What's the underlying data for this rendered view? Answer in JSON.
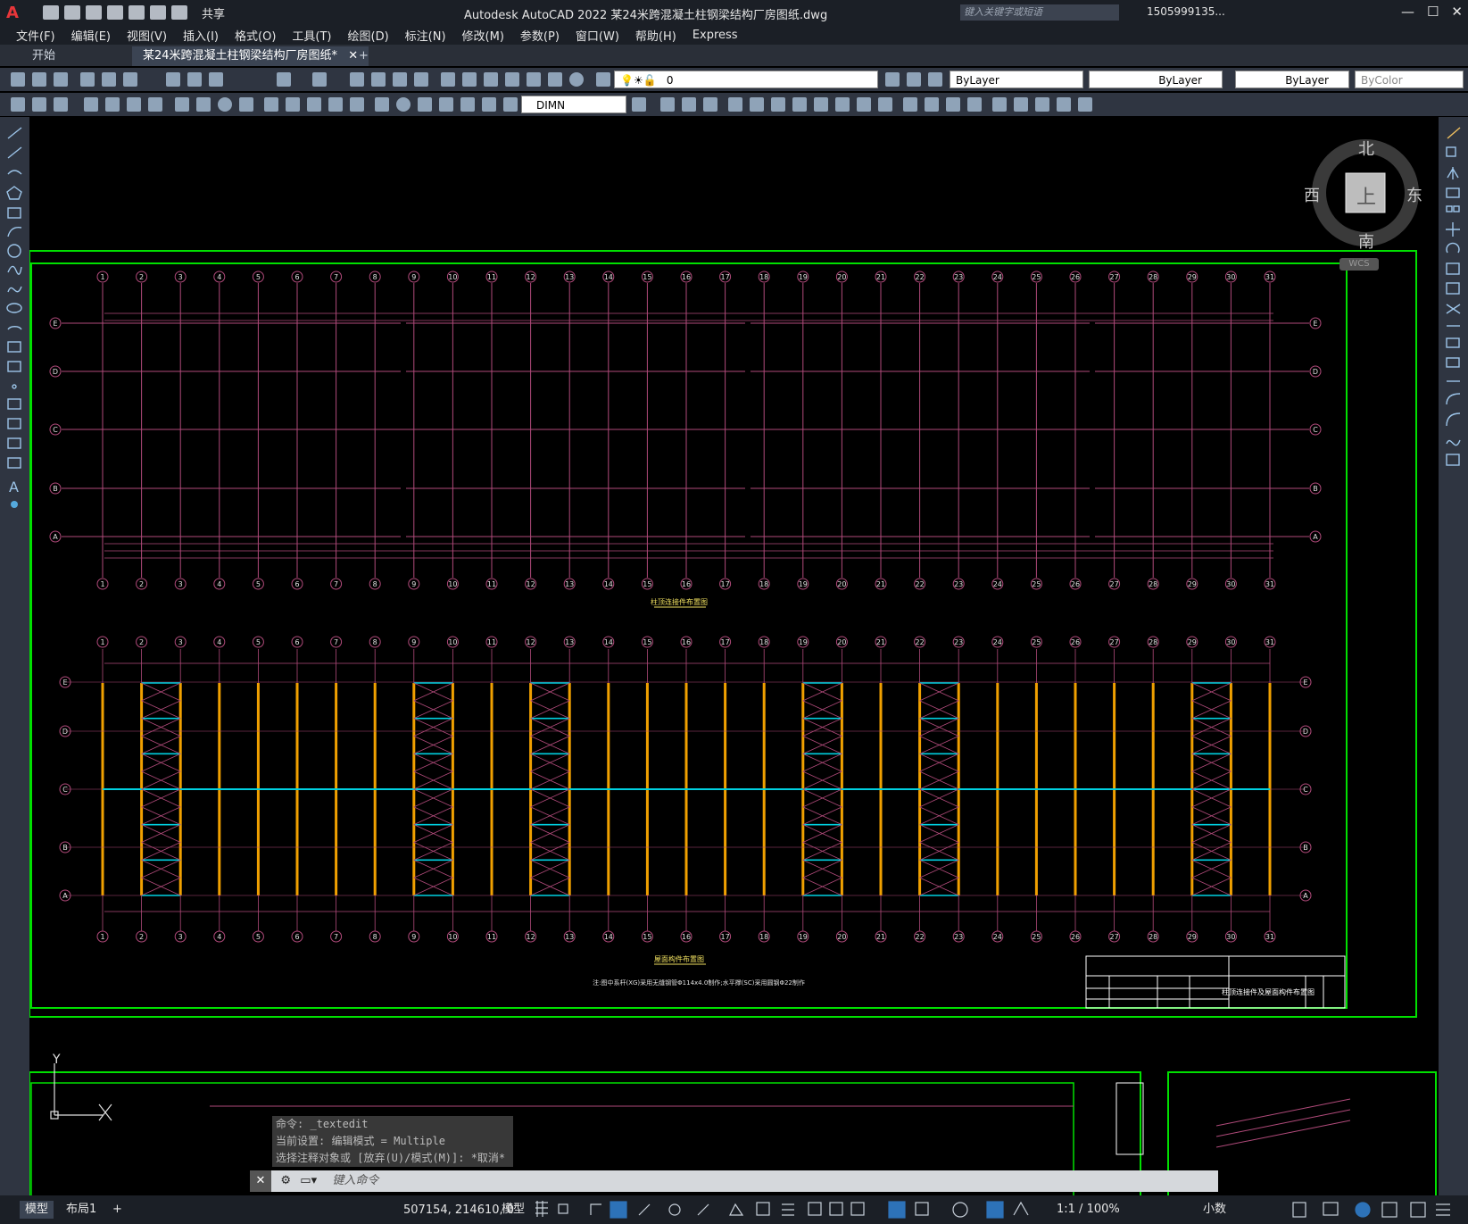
{
  "app": {
    "logo": "A",
    "title": "Autodesk AutoCAD 2022    某24米跨混凝土柱钢梁结构厂房图纸.dwg",
    "share_label": "共享",
    "search_placeholder": "键入关键字或短语",
    "user": "1505999135...",
    "window_buttons": [
      "—",
      "☐",
      "✕"
    ]
  },
  "menu": [
    "文件(F)",
    "编辑(E)",
    "视图(V)",
    "插入(I)",
    "格式(O)",
    "工具(T)",
    "绘图(D)",
    "标注(N)",
    "修改(M)",
    "参数(P)",
    "窗口(W)",
    "帮助(H)",
    "Express"
  ],
  "tabs": {
    "start": "开始",
    "active": "某24米跨混凝土柱钢梁结构厂房图纸*",
    "close": "✕",
    "add": "+"
  },
  "toolbar": {
    "layer_value": "0",
    "color": "ByLayer",
    "linetype": "ByLayer",
    "lineweight": "ByLayer",
    "plotstyle": "ByColor",
    "dimstyle": "DIMN"
  },
  "viewcube": {
    "north": "北",
    "south": "南",
    "east": "东",
    "west": "西",
    "face": "上",
    "wcs": "WCS"
  },
  "drawing": {
    "axis_numbers": [
      "1",
      "2",
      "3",
      "4",
      "5",
      "6",
      "7",
      "8",
      "9",
      "10",
      "11",
      "12",
      "13",
      "14",
      "15",
      "16",
      "17",
      "18",
      "19",
      "20",
      "21",
      "22",
      "23",
      "24",
      "25",
      "26",
      "27",
      "28",
      "29",
      "30",
      "31"
    ],
    "axis_letters": [
      "E",
      "D",
      "C",
      "B",
      "A"
    ],
    "plan1_caption": "柱顶连接件布置图",
    "plan2_caption": "屋面构件布置图",
    "note": "注:图中系杆(XG)采用无缝钢管Φ114x4.0制作;水平撑(SC)采用圆钢Φ22制作",
    "titleblock_title": "柱顶连接件及屋面构件布置图"
  },
  "command": {
    "history": [
      "命令: _textedit",
      "当前设置: 编辑模式 = Multiple",
      "选择注释对象或 [放弃(U)/模式(M)]: *取消*"
    ],
    "placeholder": "键入命令"
  },
  "status": {
    "tabs": [
      "模型",
      "布局1",
      "+"
    ],
    "coords": "507154, 214610, 0",
    "space": "模型",
    "scale": "1:1 / 100%",
    "units": "小数"
  },
  "colors": {
    "grid_magenta": "#b04a7a",
    "border_green": "#00e000",
    "column_orange": "#f0a000",
    "brace_cyan": "#00d0e0"
  }
}
